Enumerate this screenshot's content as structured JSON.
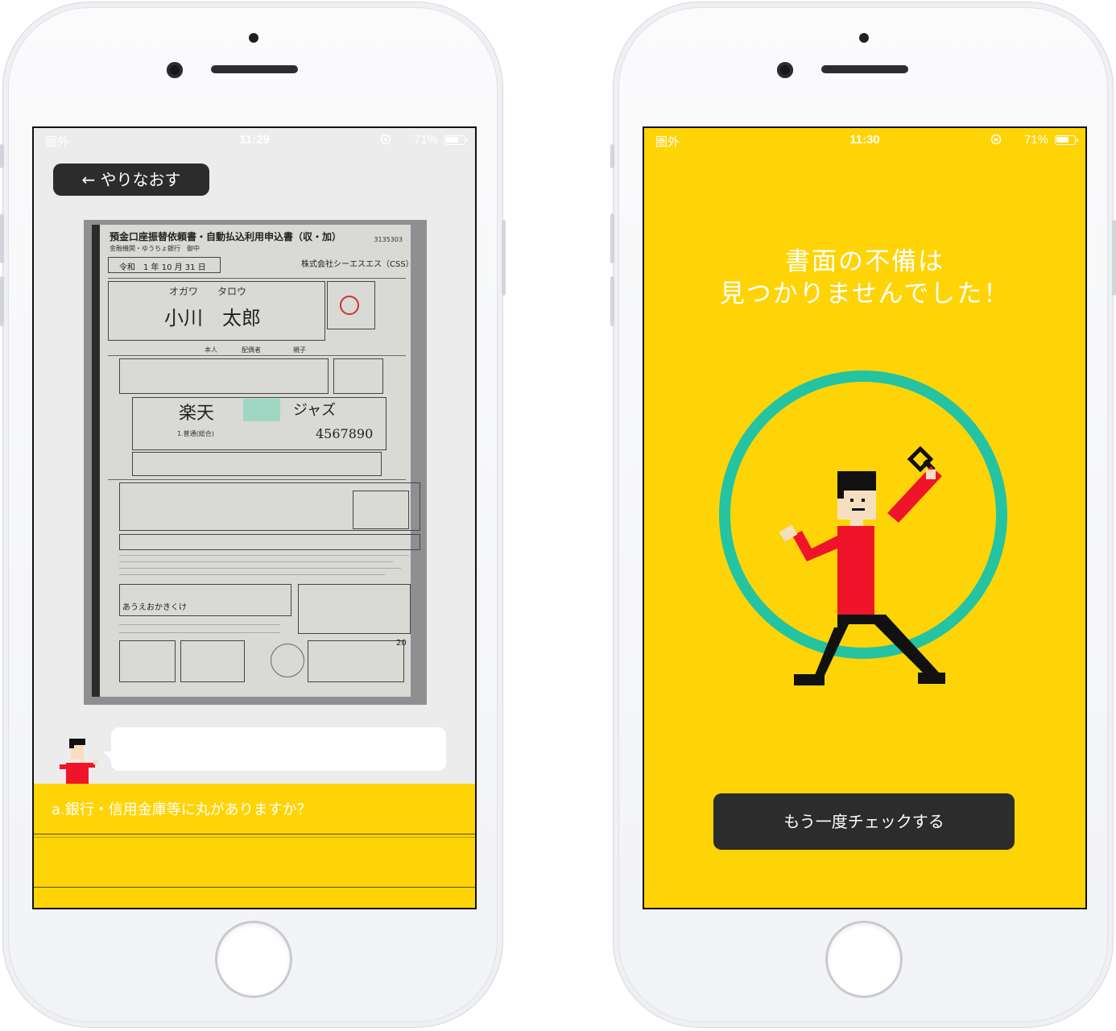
{
  "left_phone": {
    "status": {
      "carrier": "圏外",
      "time": "11:29",
      "battery": "71%"
    },
    "retry_button": "← やりなおす",
    "document": {
      "title": "預金口座振替依頼書・自動払込利用申込書（収・加）",
      "number": "3135303",
      "bank_line": "金融機関・ゆうちょ銀行　御中",
      "date": "令和　1 年 10 月 31 日",
      "name_kana": "オガワ　　タロウ",
      "name": "小川　太郎",
      "company": "株式会社シーエスエス（CSS）",
      "bank_name": "楽天",
      "branch_name": "ジャズ",
      "account_number": "4567890",
      "account_type": "1.普通(総合)",
      "relation": "本人",
      "spouse": "配偶者",
      "parent": "親子",
      "code_row": "あうえおかきくけ",
      "number_small": "20"
    },
    "bubble_text": "",
    "question": "a.銀行・信用金庫等に丸がありますか？"
  },
  "right_phone": {
    "status": {
      "carrier": "圏外",
      "time": "11:30",
      "battery": "71%"
    },
    "result_title_line1": "書面の不備は",
    "result_title_line2": "見つかりませんでした！",
    "check_again_button": "もう一度チェックする"
  },
  "colors": {
    "accent_yellow": "#ffd407",
    "button_dark": "#2c2c2c",
    "circle_teal": "#24c3a2",
    "shirt_red": "#f0142b"
  }
}
